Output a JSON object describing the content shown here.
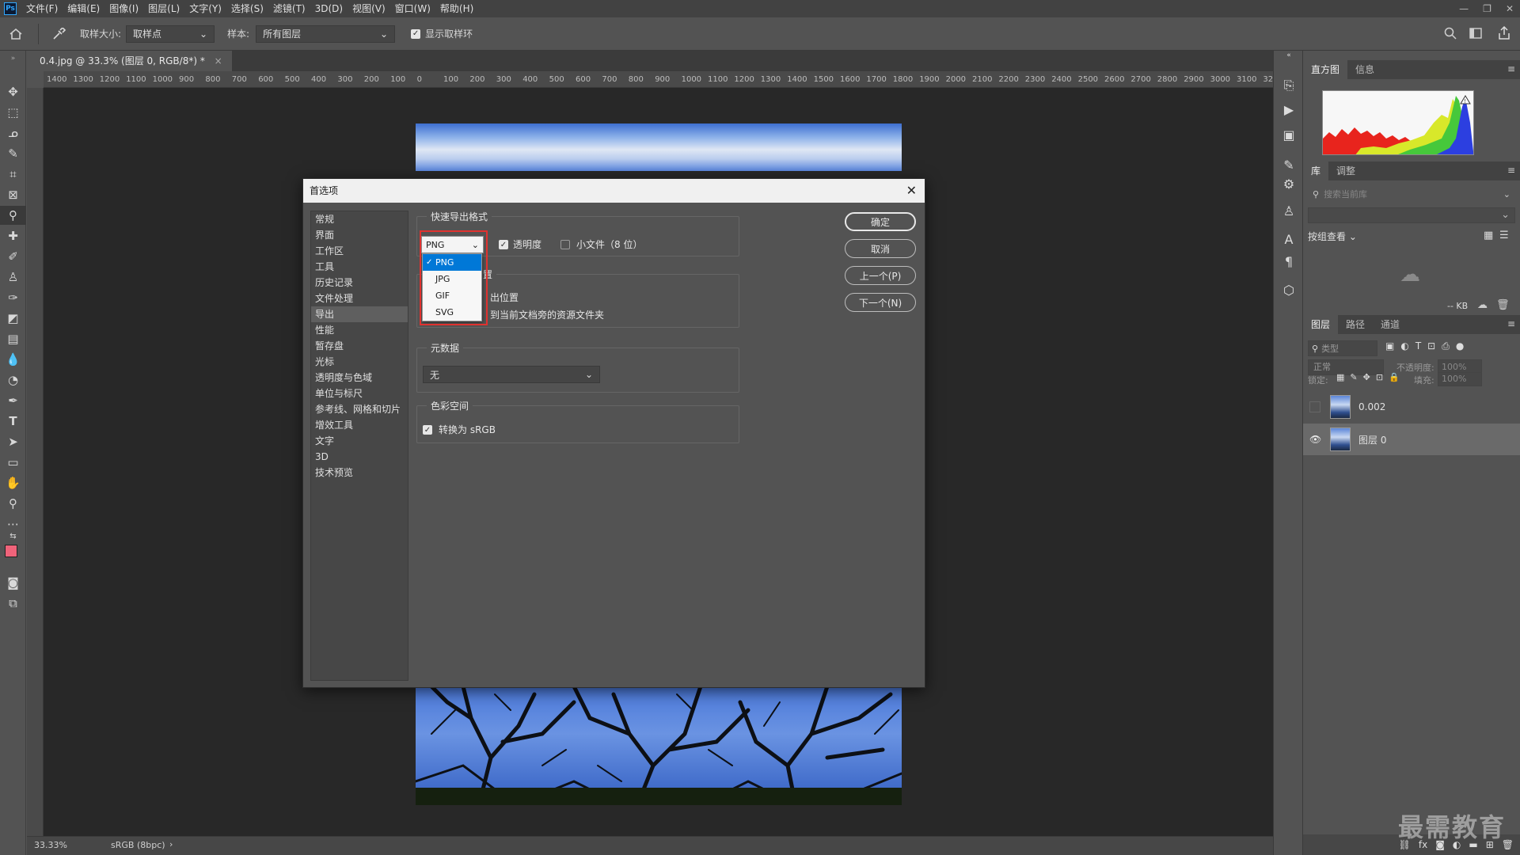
{
  "app": {
    "logo_text": "Ps",
    "window_controls": [
      "—",
      "❐",
      "✕"
    ]
  },
  "menu": [
    "文件(F)",
    "编辑(E)",
    "图像(I)",
    "图层(L)",
    "文字(Y)",
    "选择(S)",
    "滤镜(T)",
    "3D(D)",
    "视图(V)",
    "窗口(W)",
    "帮助(H)"
  ],
  "options_bar": {
    "sample_size_label": "取样大小:",
    "sample_size_value": "取样点",
    "sample_label": "样本:",
    "sample_value": "所有图层",
    "show_ring_label": "显示取样环",
    "show_ring_checked": true
  },
  "document": {
    "tab_title": "0.4.jpg @ 33.3% (图层 0, RGB/8*) *",
    "ruler_ticks": [
      "1400",
      "1300",
      "1200",
      "1100",
      "1000",
      "900",
      "800",
      "700",
      "600",
      "500",
      "400",
      "300",
      "200",
      "100",
      "0",
      "100",
      "200",
      "300",
      "400",
      "500",
      "600",
      "700",
      "800",
      "900",
      "1000",
      "1100",
      "1200",
      "1300",
      "1400",
      "1500",
      "1600",
      "1700",
      "1800",
      "1900",
      "2000",
      "2100",
      "2200",
      "2300",
      "2400",
      "2500",
      "2600",
      "2700",
      "2800",
      "2900",
      "3000",
      "3100",
      "32"
    ],
    "zoom": "33.33%",
    "color_profile": "sRGB (8bpc)"
  },
  "dialog": {
    "title": "首选项",
    "categories": [
      "常规",
      "界面",
      "工作区",
      "工具",
      "历史记录",
      "文件处理",
      "导出",
      "性能",
      "暂存盘",
      "光标",
      "透明度与色域",
      "单位与标尺",
      "参考线、网格和切片",
      "增效工具",
      "文字",
      "3D",
      "技术预览"
    ],
    "selected_category": "导出",
    "quick_export_title": "快速导出格式",
    "format_value": "PNG",
    "format_options": [
      "PNG",
      "JPG",
      "GIF",
      "SVG"
    ],
    "transparency_label": "透明度",
    "transparency_checked": true,
    "small_file_label": "小文件（8 位）",
    "small_file_checked": false,
    "location_title_partial": "置",
    "location_option1_partial": "出位置",
    "location_option2_partial": "到当前文档旁的资源文件夹",
    "metadata_title": "元数据",
    "metadata_value": "无",
    "colorspace_title": "色彩空间",
    "convert_srgb_label": "转换为 sRGB",
    "convert_srgb_checked": true,
    "buttons": {
      "ok": "确定",
      "cancel": "取消",
      "prev": "上一个(P)",
      "next": "下一个(N)"
    }
  },
  "panels": {
    "histogram_tabs": [
      "直方图",
      "信息"
    ],
    "library_tabs": [
      "库",
      "调整"
    ],
    "library_search_placeholder": "搜索当前库",
    "library_view_label": "按组查看",
    "library_size": "-- KB",
    "layers_tabs": [
      "图层",
      "路径",
      "通道"
    ],
    "layers_filter_label": "类型",
    "blend_mode": "正常",
    "opacity_label": "不透明度:",
    "opacity_value": "100%",
    "lock_label": "锁定:",
    "fill_label": "填充:",
    "fill_value": "100%",
    "layers": [
      {
        "name": "0.002",
        "visible": false
      },
      {
        "name": "图层 0",
        "visible": true,
        "selected": true
      }
    ]
  },
  "watermark": "最需教育",
  "colors": {
    "foreground": "#f0637a",
    "background": "#ffffff",
    "accent": "#0078d7",
    "highlight_frame": "#e0322f"
  }
}
